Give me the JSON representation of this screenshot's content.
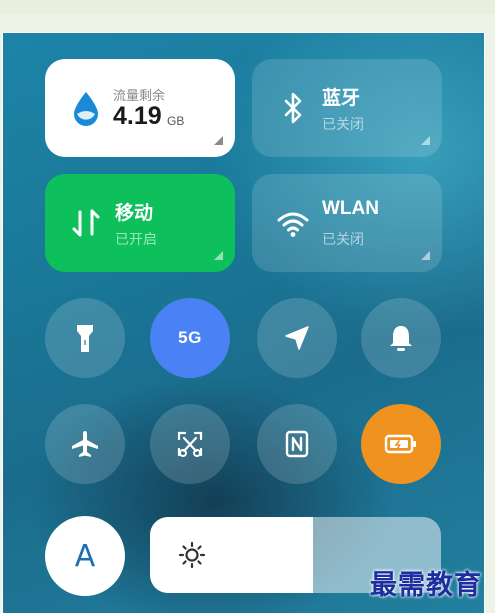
{
  "data_tile": {
    "label": "流量剩余",
    "value": "4.19",
    "unit": "GB"
  },
  "bluetooth": {
    "title": "蓝牙",
    "status": "已关闭"
  },
  "mobile": {
    "title": "移动",
    "status": "已开启"
  },
  "wlan": {
    "title": "WLAN",
    "status": "已关闭"
  },
  "toggles": {
    "network_5g_label": "5G",
    "font_label": "A"
  },
  "brightness": {
    "level": 0.56
  },
  "watermark": "最需教育",
  "colors": {
    "mobile_active": "#0dc05c",
    "fiveg_active": "#4a82f5",
    "battery_saver_active": "#ef9220",
    "font_icon": "#1b6fb5"
  },
  "icons": [
    "water-drop-icon",
    "bluetooth-icon",
    "transfer-arrows-icon",
    "wifi-icon",
    "flashlight-icon",
    "location-icon",
    "bell-icon",
    "airplane-icon",
    "screenshot-scissors-icon",
    "nfc-icon",
    "battery-saver-icon",
    "brightness-sun-icon"
  ]
}
